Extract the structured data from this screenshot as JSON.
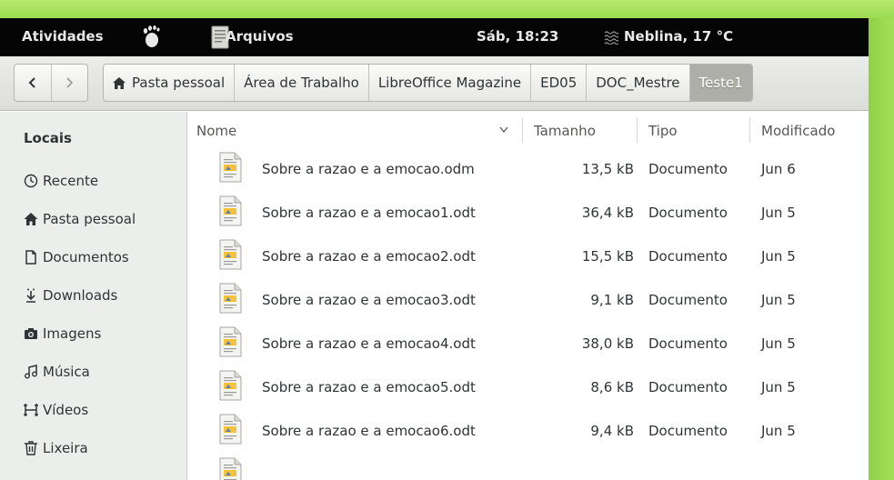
{
  "topbar": {
    "activities": "Atividades",
    "app_name": "Arquivos",
    "clock": "Sáb, 18:23",
    "weather": "Neblina, 17 °C"
  },
  "nav": {
    "back_icon": "chevron-left-icon",
    "forward_icon": "chevron-right-icon"
  },
  "breadcrumbs": [
    {
      "label": "Pasta pessoal",
      "icon": "home-icon"
    },
    {
      "label": "Área de Trabalho"
    },
    {
      "label": "LibreOffice Magazine"
    },
    {
      "label": "ED05"
    },
    {
      "label": "DOC_Mestre"
    },
    {
      "label": "Teste1",
      "active": true
    }
  ],
  "sidebar": {
    "title": "Locais",
    "items": [
      {
        "label": "Recente",
        "icon": "clock-icon"
      },
      {
        "label": "Pasta pessoal",
        "icon": "home-icon"
      },
      {
        "label": "Documentos",
        "icon": "document-icon"
      },
      {
        "label": "Downloads",
        "icon": "download-icon"
      },
      {
        "label": "Imagens",
        "icon": "camera-icon"
      },
      {
        "label": "Música",
        "icon": "music-icon"
      },
      {
        "label": "Vídeos",
        "icon": "film-icon"
      },
      {
        "label": "Lixeira",
        "icon": "trash-icon"
      }
    ]
  },
  "columns": {
    "name": "Nome",
    "size": "Tamanho",
    "type": "Tipo",
    "modified": "Modificado"
  },
  "files": [
    {
      "name": "Sobre a razao e a emocao.odm",
      "size": "13,5 kB",
      "type": "Documento",
      "modified": "Jun 6"
    },
    {
      "name": "Sobre a razao e a emocao1.odt",
      "size": "36,4 kB",
      "type": "Documento",
      "modified": "Jun 5"
    },
    {
      "name": "Sobre a razao e a emocao2.odt",
      "size": "15,5 kB",
      "type": "Documento",
      "modified": "Jun 5"
    },
    {
      "name": "Sobre a razao e a emocao3.odt",
      "size": "9,1 kB",
      "type": "Documento",
      "modified": "Jun 5"
    },
    {
      "name": "Sobre a razao e a emocao4.odt",
      "size": "38,0 kB",
      "type": "Documento",
      "modified": "Jun 5"
    },
    {
      "name": "Sobre a razao e a emocao5.odt",
      "size": "8,6 kB",
      "type": "Documento",
      "modified": "Jun 5"
    },
    {
      "name": "Sobre a razao e a emocao6.odt",
      "size": "9,4 kB",
      "type": "Documento",
      "modified": "Jun 5"
    },
    {
      "name": "",
      "size": "",
      "type": "",
      "modified": ""
    }
  ],
  "colors": {
    "wallpaper": "#9edd54",
    "topbar": "#050505",
    "active_crumb": "#aeaea8",
    "sidebar": "#eceeec"
  }
}
